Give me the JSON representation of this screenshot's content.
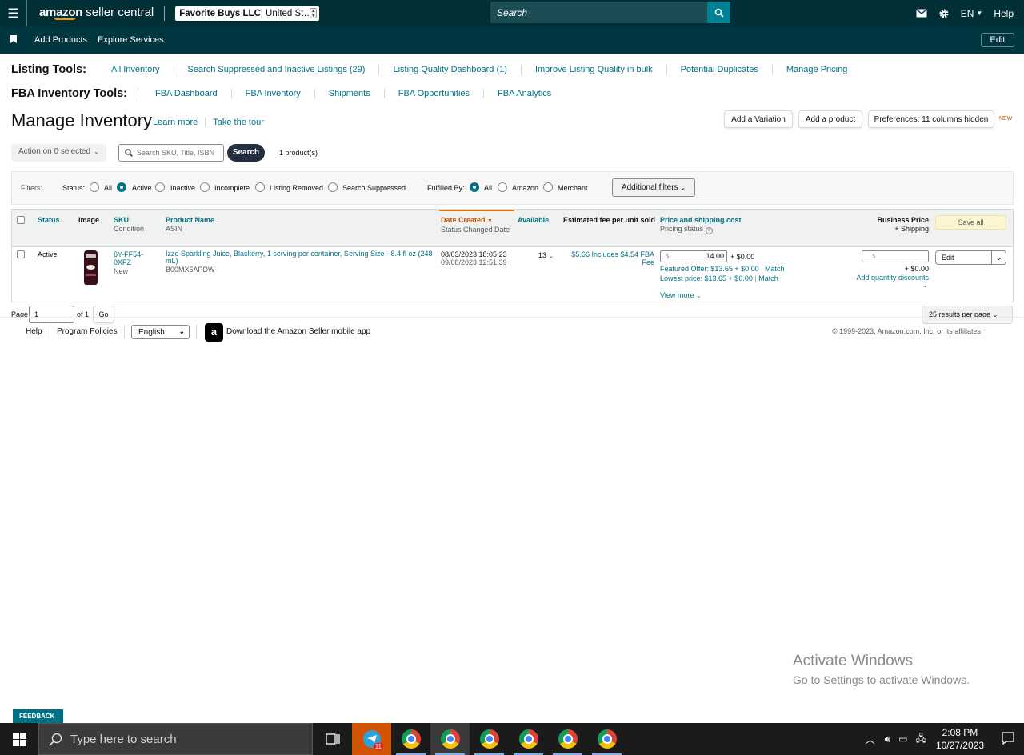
{
  "topbar": {
    "logo_brand": "amazon",
    "logo_product": " seller central",
    "account_bold": "Favorite Buys LLC",
    "account_rest": " | United St…",
    "search_placeholder": "Search",
    "language": "EN",
    "help": "Help"
  },
  "subbar": {
    "links": [
      "Add Products",
      "Explore Services"
    ],
    "edit": "Edit"
  },
  "listing_tools": {
    "heading": "Listing Tools:",
    "links": [
      "All Inventory",
      "Search Suppressed and Inactive Listings (29)",
      "Listing Quality Dashboard (1)",
      "Improve Listing Quality in bulk",
      "Potential Duplicates",
      "Manage Pricing"
    ]
  },
  "fba_tools": {
    "heading": "FBA Inventory Tools:",
    "links": [
      "FBA Dashboard",
      "FBA Inventory",
      "Shipments",
      "FBA Opportunities",
      "FBA Analytics"
    ]
  },
  "page": {
    "title": "Manage Inventory",
    "learn_more": "Learn more",
    "tour": "Take the tour",
    "add_variation": "Add a Variation",
    "add_product": "Add a product",
    "preferences": "Preferences: 11 columns hidden",
    "new_tag": "NEW"
  },
  "toolbar": {
    "action": "Action on 0 selected",
    "search_placeholder": "Search SKU, Title, ISBN",
    "search_button": "Search",
    "count": "1 product(s)"
  },
  "filters": {
    "label": "Filters:",
    "status_label": "Status:",
    "status_options": [
      "All",
      "Active",
      "Inactive",
      "Incomplete",
      "Listing Removed",
      "Search Suppressed"
    ],
    "status_selected": "Active",
    "fulfilled_label": "Fulfilled By:",
    "fulfilled_options": [
      "All",
      "Amazon",
      "Merchant"
    ],
    "fulfilled_selected": "All",
    "additional": "Additional filters"
  },
  "table": {
    "headers": {
      "status": "Status",
      "image": "Image",
      "sku": "SKU",
      "condition": "Condition",
      "product_name": "Product Name",
      "asin": "ASIN",
      "date_created": "Date Created",
      "status_changed": "Status Changed Date",
      "available": "Available",
      "fee": "Estimated fee per unit sold",
      "price": "Price and shipping cost",
      "pricing_status": "Pricing status",
      "business_price": "Business Price",
      "business_shipping": "+ Shipping",
      "save_all": "Save all"
    },
    "row": {
      "status": "Active",
      "sku_line1": "6Y-FF54-",
      "sku_line2": "0XFZ",
      "condition": "New",
      "product_name": "Izze Sparkling Juice, Blackerry, 1 serving per container, Serving Size - 8.4 fl oz (248 mL)",
      "asin": "B00MX5APDW",
      "date_created": "08/03/2023 18:05:23",
      "status_changed": "09/08/2023 12:51:39",
      "available": "13",
      "fee": "$5.66 Includes $4.54 FBA Fee",
      "price_currency": "$",
      "price": "14.00",
      "shipping": "+ $0.00",
      "featured_offer": "Featured Offer: $13.65 + $0.00",
      "lowest_price": "Lowest price: $13.65 + $0.00",
      "match": "Match",
      "view_more": "View more",
      "business_currency": "$",
      "business_shipping": "+ $0.00",
      "quantity_discounts": "Add quantity discounts",
      "edit": "Edit"
    }
  },
  "pager": {
    "label": "Page",
    "value": "1",
    "of": "of 1",
    "go": "Go",
    "per_page": "25 results per page"
  },
  "footer": {
    "help": "Help",
    "policies": "Program Policies",
    "language": "English",
    "app": "Download the Amazon Seller mobile app",
    "copyright": "© 1999-2023, Amazon.com, Inc. or its affiliates"
  },
  "watermark": {
    "line1": "Activate Windows",
    "line2": "Go to Settings to activate Windows."
  },
  "feedback": "FEEDBACK",
  "taskbar": {
    "search_placeholder": "Type here to search",
    "telegram_badge": "11",
    "time": "2:08 PM",
    "date": "10/27/2023"
  }
}
